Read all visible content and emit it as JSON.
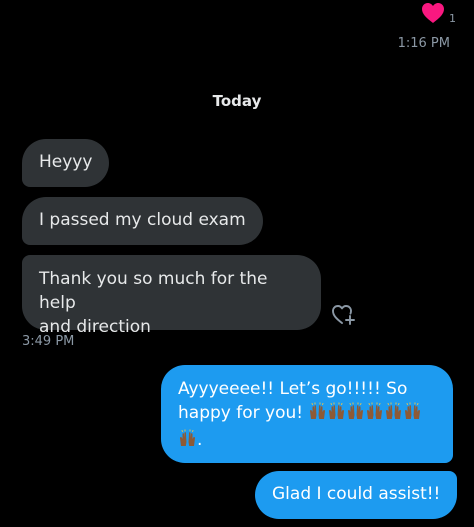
{
  "reaction": {
    "count": "1",
    "icon": "heart-icon",
    "color": "#f91880"
  },
  "top_time": "1:16 PM",
  "day_divider": "Today",
  "incoming": [
    {
      "text": "Heyyy"
    },
    {
      "text": "I passed my cloud exam"
    },
    {
      "text": "Thank you so much for the help\nand direction"
    }
  ],
  "incoming_time": "3:49 PM",
  "outgoing": [
    {
      "text_line1": "Ayyyeeee!!  Let’s go!!!!! So",
      "text_line2": "happy for you!",
      "text_end": ".",
      "emoji": "raising-hands",
      "emoji_count": 7
    },
    {
      "text": "Glad I could assist!!"
    }
  ],
  "colors": {
    "background": "#000000",
    "incoming_bubble": "#2f3336",
    "outgoing_bubble": "#1d9bf0",
    "meta_text": "#8b98a5"
  }
}
